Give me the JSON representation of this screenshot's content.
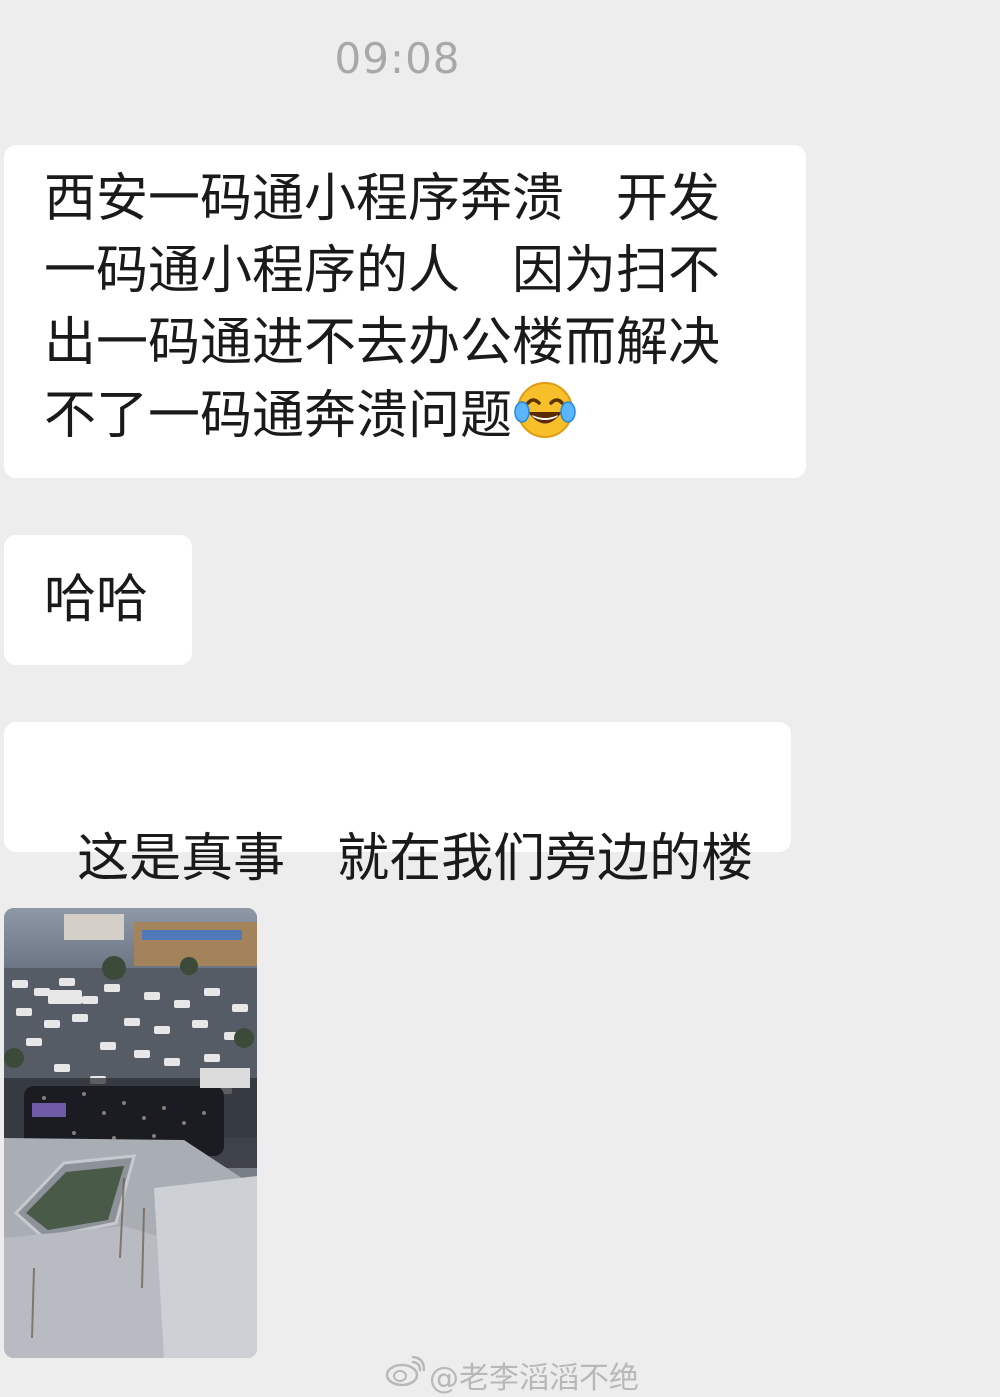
{
  "chat": {
    "timestamp": "09:08",
    "messages": [
      {
        "lines": [
          "西安一码通小程序奔溃　开发",
          "一码通小程序的人　因为扫不",
          "出一码通进不去办公楼而解决",
          "不了一码通奔溃问题"
        ],
        "emoji": "tears-of-joy-emoji"
      },
      {
        "text": "哈哈"
      },
      {
        "text": "这是真事　就在我们旁边的楼"
      }
    ],
    "image": {
      "description_icon": "photo-thumbnail"
    }
  },
  "watermark": {
    "text": "@老李滔滔不绝",
    "icon": "weibo-icon"
  },
  "colors": {
    "background": "#ededed",
    "bubble": "#ffffff",
    "timestamp": "#a8a8a8",
    "watermark": "#b8b8b8"
  }
}
